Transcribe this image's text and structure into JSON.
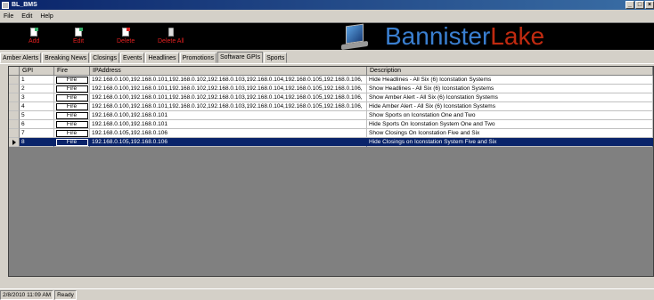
{
  "window": {
    "title": "BL_BMS",
    "controls": [
      "_",
      "□",
      "×"
    ]
  },
  "menu": [
    "File",
    "Edit",
    "Help"
  ],
  "toolbar": {
    "add": "Add",
    "edit": "Edit",
    "delete": "Delete",
    "delete_all": "Delete All"
  },
  "logo": {
    "part1": "Bannister",
    "part2": "Lake"
  },
  "tabs": [
    "Amber Alerts",
    "Breaking News",
    "Closings",
    "Events",
    "Headlines",
    "Promotions",
    "Software GPIs",
    "Sports"
  ],
  "active_tab": "Software GPIs",
  "grid": {
    "columns": [
      "GPI",
      "Fire",
      "IPAddress",
      "Description"
    ],
    "rows": [
      {
        "gpi": "1",
        "fire": "Fire",
        "ip": "192.168.0.100,192.168.0.101,192.168.0.102,192.168.0.103,192.168.0.104,192.168.0.105,192.168.0.106,",
        "desc": "Hide Headlines - All Six (6)  Iconstation Systems"
      },
      {
        "gpi": "2",
        "fire": "Fire",
        "ip": "192.168.0.100,192.168.0.101,192.168.0.102,192.168.0.103,192.168.0.104,192.168.0.105,192.168.0.106,",
        "desc": "Show Headlines - All Six (6)  Iconstation Systems"
      },
      {
        "gpi": "3",
        "fire": "Fire",
        "ip": "192.168.0.100,192.168.0.101,192.168.0.102,192.168.0.103,192.168.0.104,192.168.0.105,192.168.0.106,",
        "desc": "Show Amber Alert - All Six (6) Iconstation Systems"
      },
      {
        "gpi": "4",
        "fire": "Fire",
        "ip": "192.168.0.100,192.168.0.101,192.168.0.102,192.168.0.103,192.168.0.104,192.168.0.105,192.168.0.106,",
        "desc": "Hide Amber Alert - All Six (6) Iconstation Systems"
      },
      {
        "gpi": "5",
        "fire": "Fire",
        "ip": "192.168.0.100,192.168.0.101",
        "desc": "Show Sports on Iconstation One and Two"
      },
      {
        "gpi": "6",
        "fire": "Fire",
        "ip": "192.168.0.100,192.168.0.101",
        "desc": "Hide Sports On Iconstation System One and Two"
      },
      {
        "gpi": "7",
        "fire": "Fire",
        "ip": "192.168.0.105,192.168.0.106",
        "desc": "Show Closings On Iconstation Five and Six"
      },
      {
        "gpi": "8",
        "fire": "Fire",
        "ip": "192.168.0.105,192.168.0.106",
        "desc": "Hide Closings on Iconstation System Five and Six"
      }
    ],
    "selected_row": 8
  },
  "status": {
    "datetime": "2/8/2010 11:09 AM",
    "state": "Ready"
  },
  "colors": {
    "selection": "#0a246a",
    "toolbar_bg": "#000000",
    "toolbar_text": "#e02020",
    "logo_blue": "#3a7fd0",
    "logo_red": "#c02a10"
  }
}
